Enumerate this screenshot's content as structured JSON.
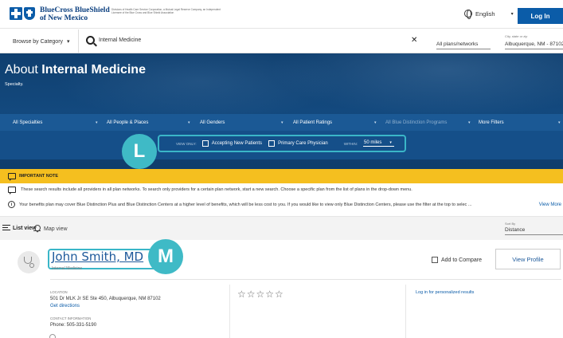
{
  "header": {
    "brand_line1": "BlueCross BlueShield",
    "brand_line2": "of New Mexico",
    "tagline": "Divisions of Health Care Service Corporation, a Mutual Legal Reserve Company, an Independent Licensee of the Blue Cross and Blue Shield Association",
    "language": "English",
    "login_label": "Log In"
  },
  "search": {
    "browse_label": "Browse by Category",
    "query": "Internal Medicine",
    "plans_value": "All plans/networks",
    "location_label": "City, state or zip",
    "location_value": "Albuquerque, NM - 87102"
  },
  "hero": {
    "title_prefix": "About ",
    "title_bold": "Internal Medicine",
    "subtitle": "Specialty."
  },
  "filters": [
    {
      "label": "All Specialties"
    },
    {
      "label": "All People & Places"
    },
    {
      "label": "All Genders"
    },
    {
      "label": "All Patient Ratings"
    },
    {
      "label": "All Blue Distinction Programs"
    },
    {
      "label": "More Filters"
    }
  ],
  "view_only": {
    "label": "VIEW ONLY:",
    "accepting": "Accepting New Patients",
    "primary": "Primary Care Physician",
    "within_label": "WITHIN:",
    "miles": "50 miles"
  },
  "badges": {
    "l": "L",
    "m": "M"
  },
  "note": {
    "title": "IMPORTANT NOTE",
    "line1": "These search results include all providers in all plan networks. To search only providers for a certain plan network, start a new search. Choose a specific plan from the list of plans in the drop-down menu.",
    "line2": "Your benefits plan may cover Blue Distinction Plus and Blue Distinction Centers at a higher level of benefits, which will be less cost to you. If you would like to view only Blue Distinction Centers, please use the filter at the top to selec ...",
    "view_more": "View More"
  },
  "view_bar": {
    "list_view": "List view",
    "map_view": "Map view",
    "sort_label": "Sort By",
    "sort_value": "Distance"
  },
  "provider": {
    "name": "John Smith, MD",
    "specialty": "Internal Medicine",
    "compare_label": "Add to Compare",
    "profile_label": "View Profile",
    "location_label": "LOCATION",
    "address": "501 Dr MLK Jr SE Ste 450, Albuquerque, NM 87102",
    "directions": "Get directions",
    "contact_label": "CONTACT INFORMATION",
    "phone": "Phone: 505-331-5190",
    "stars": "☆☆☆☆☆",
    "personalized": "Log in for personalized results"
  },
  "colors": {
    "brand_blue": "#0b5ca8",
    "hero_blue": "#13497e",
    "accent_teal": "#3fbac6",
    "note_yellow": "#f5bf1f"
  }
}
